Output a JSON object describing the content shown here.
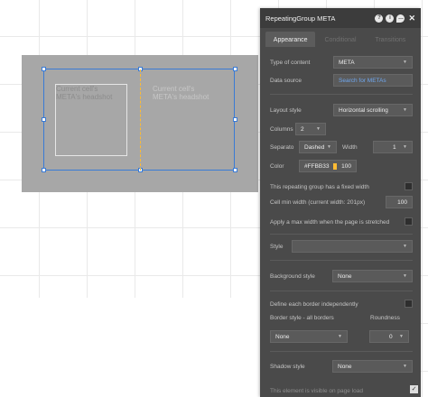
{
  "canvas": {
    "cell1_text": "Current cell's\nMETA's headshot",
    "cell2_text": "Current cell's\nMETA's headshot"
  },
  "panel": {
    "title": "RepeatingGroup META",
    "header_icons": [
      "help-icon",
      "info-icon",
      "comment-icon",
      "close-icon"
    ],
    "close_label": "✕",
    "tabs": [
      {
        "label": "Appearance",
        "active": true
      },
      {
        "label": "Conditional",
        "active": false
      },
      {
        "label": "Transitions",
        "active": false
      }
    ],
    "type_of_content": {
      "label": "Type of content",
      "value": "META"
    },
    "data_source": {
      "label": "Data source",
      "value": "Search for METAs"
    },
    "layout_style": {
      "label": "Layout style",
      "value": "Horizontal scrolling"
    },
    "columns": {
      "label": "Columns",
      "value": "2"
    },
    "separator": {
      "label": "Separato",
      "style": "Dashed",
      "width_label": "Width",
      "width_value": "1"
    },
    "color": {
      "label": "Color",
      "hex": "#FFBB33",
      "opacity": "100",
      "swatch": "#ffbb33"
    },
    "fixed_width": {
      "label": "This repeating group has a fixed width"
    },
    "cell_min_width": {
      "label": "Cell min width (current width: 201px)",
      "value": "100"
    },
    "max_width": {
      "label": "Apply a max width when the page is stretched"
    },
    "style": {
      "label": "Style",
      "value": ""
    },
    "background_style": {
      "label": "Background style",
      "value": "None"
    },
    "border_independent": {
      "label": "Define each border independently"
    },
    "border_style": {
      "label": "Border style - all borders",
      "value": "None"
    },
    "roundness": {
      "label": "Roundness",
      "value": "0"
    },
    "shadow_style": {
      "label": "Shadow style",
      "value": "None"
    },
    "visible_on_load": {
      "label": "This element is visible on page load"
    }
  },
  "colors": {
    "panel_bg": "#4a4a4a",
    "header_bg": "#3c3c3c",
    "accent_link": "#6fa7ef",
    "selection": "#3a7bd5",
    "separator": "#ffbb33"
  }
}
